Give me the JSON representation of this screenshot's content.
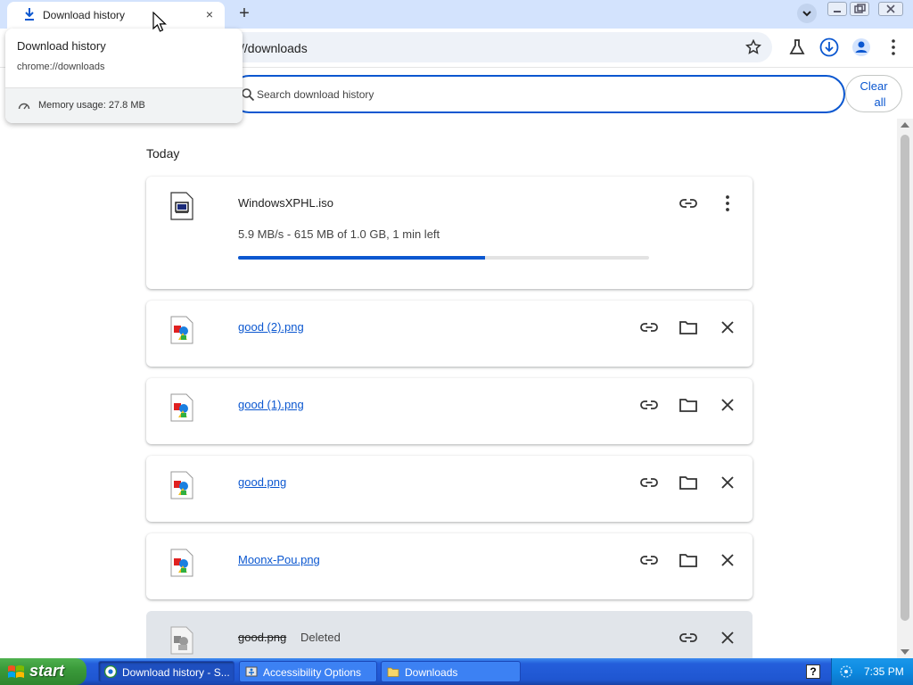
{
  "browser": {
    "tab": {
      "title": "Download history",
      "close_glyph": "×"
    },
    "new_tab_glyph": "+",
    "address": {
      "url": "//downloads"
    },
    "icons": [
      "download-icon",
      "close-icon",
      "plus-icon",
      "tab-search-icon",
      "star-icon",
      "labs-flask-icon",
      "downloads-toolbar-icon",
      "profile-icon",
      "kebab-menu-icon"
    ]
  },
  "tooltip": {
    "title": "Download history",
    "url": "chrome://downloads",
    "memory": "Memory usage: 27.8 MB"
  },
  "search": {
    "placeholder": "Search download history"
  },
  "clear_all": {
    "line1": "Clear",
    "line2": "all"
  },
  "section": {
    "title": "Today"
  },
  "downloads": [
    {
      "name": "WindowsXPHL.iso",
      "status": "5.9 MB/s - 615 MB of 1.0 GB, 1 min left",
      "progress": 0.6,
      "state": "in-progress"
    },
    {
      "name": "good (2).png",
      "state": "complete"
    },
    {
      "name": "good (1).png",
      "state": "complete"
    },
    {
      "name": "good.png",
      "state": "complete"
    },
    {
      "name": "Moonx-Pou.png",
      "state": "complete"
    },
    {
      "name": "good.png",
      "state": "deleted",
      "tag": "Deleted"
    }
  ],
  "taskbar": {
    "start": "start",
    "tasks": [
      {
        "label": "Download history - S...",
        "active": true
      },
      {
        "label": "Accessibility Options",
        "active": false
      },
      {
        "label": "Downloads",
        "active": false
      }
    ],
    "help": "?",
    "clock": "7:35 PM"
  },
  "colors": {
    "accent": "#0b57d0",
    "tabstrip": "#d3e3fd",
    "taskbar": "#245edb",
    "start": "#3a9a3a"
  }
}
